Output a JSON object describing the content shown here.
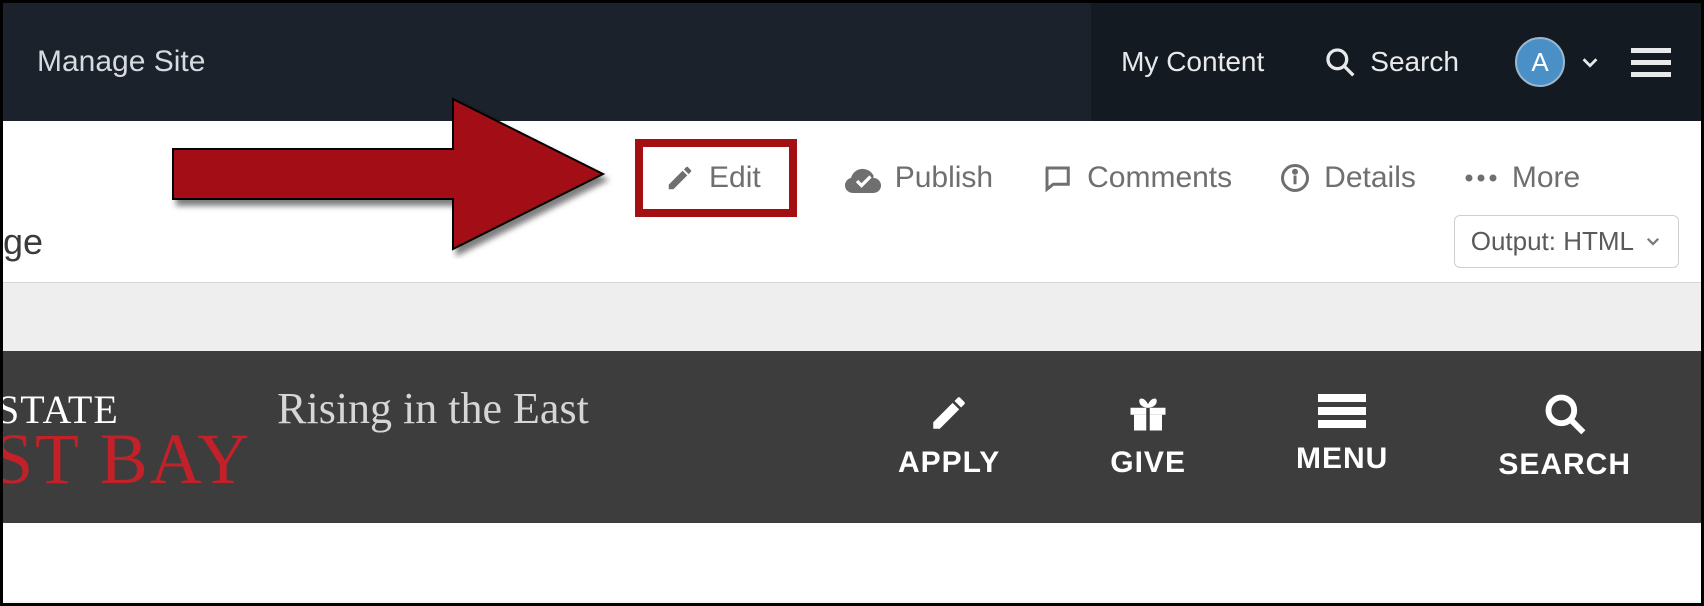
{
  "cms": {
    "manage_site": "Manage Site",
    "my_content": "My Content",
    "search": "Search",
    "avatar_initial": "A"
  },
  "actions": {
    "edit": "Edit",
    "publish": "Publish",
    "comments": "Comments",
    "details": "Details",
    "more": "More"
  },
  "page_label_fragment": "ge",
  "output_dropdown": "Output: HTML",
  "brand": {
    "line1": "STATE",
    "line2": "ST BAY",
    "tagline": "Rising in the East"
  },
  "site_nav": {
    "apply": "APPLY",
    "give": "GIVE",
    "menu": "MENU",
    "search": "SEARCH"
  },
  "annotation": {
    "target": "edit-button",
    "color": "#a30f12"
  }
}
